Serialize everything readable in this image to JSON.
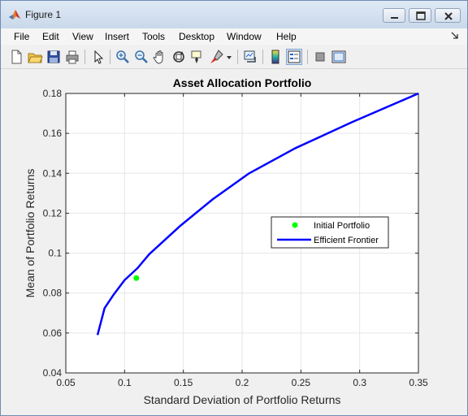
{
  "window": {
    "title": "Figure 1",
    "app_icon": "matlab-icon",
    "buttons": [
      {
        "name": "minimize-icon"
      },
      {
        "name": "maximize-icon"
      },
      {
        "name": "close-icon"
      }
    ]
  },
  "menu": {
    "items": [
      "File",
      "Edit",
      "View",
      "Insert",
      "Tools",
      "Desktop",
      "Window",
      "Help"
    ],
    "dock_icon": "dock-arrow-icon"
  },
  "toolbar": {
    "icons": [
      "new-figure-icon",
      "open-file-icon",
      "save-icon",
      "print-icon",
      "edit-plot-arrow-icon",
      "zoom-in-icon",
      "zoom-out-icon",
      "pan-hand-icon",
      "rotate-3d-icon",
      "data-cursor-icon",
      "brush-icon",
      "brush-dropdown-icon",
      "link-plot-icon",
      "insert-colorbar-icon",
      "insert-legend-icon",
      "hide-plot-tools-icon",
      "show-plot-tools-icon"
    ]
  },
  "colors": {
    "frontier": "#0000ff",
    "initial": "#00ff00",
    "grid": "#e6e6e6",
    "axes_bg": "#ffffff"
  },
  "chart_data": {
    "type": "line",
    "title": "Asset Allocation Portfolio",
    "xlabel": "Standard Deviation of Portfolio Returns",
    "ylabel": "Mean of Portfolio Returns",
    "xlim": [
      0.05,
      0.35
    ],
    "ylim": [
      0.04,
      0.18
    ],
    "xticks": [
      0.05,
      0.1,
      0.15,
      0.2,
      0.25,
      0.3,
      0.35
    ],
    "xtick_labels": [
      "0.05",
      "0.1",
      "0.15",
      "0.2",
      "0.25",
      "0.3",
      "0.35"
    ],
    "yticks": [
      0.04,
      0.06,
      0.08,
      0.1,
      0.12,
      0.14,
      0.16,
      0.18
    ],
    "ytick_labels": [
      "0.04",
      "0.06",
      "0.08",
      "0.1",
      "0.12",
      "0.14",
      "0.16",
      "0.18"
    ],
    "grid": true,
    "legend_placement": "center-right",
    "series": [
      {
        "name": "Initial Portfolio",
        "kind": "scatter",
        "x": [
          0.11
        ],
        "y": [
          0.0875
        ]
      },
      {
        "name": "Efficient Frontier",
        "kind": "line",
        "x": [
          0.077,
          0.083,
          0.091,
          0.1,
          0.111,
          0.121,
          0.147,
          0.175,
          0.206,
          0.245,
          0.293,
          0.35
        ],
        "y": [
          0.059,
          0.0725,
          0.0795,
          0.0865,
          0.0925,
          0.0995,
          0.1135,
          0.127,
          0.14,
          0.1525,
          0.1655,
          0.18
        ]
      }
    ]
  }
}
